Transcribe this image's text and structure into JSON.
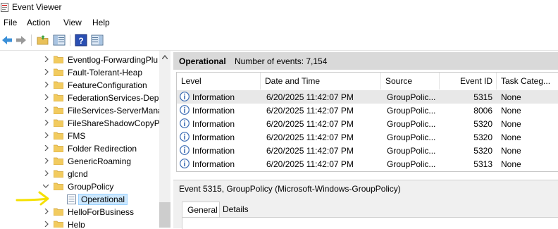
{
  "window": {
    "title": "Event Viewer"
  },
  "menu": {
    "items": [
      "File",
      "Action",
      "View",
      "Help"
    ]
  },
  "toolbar": {
    "icons": [
      "back-arrow-icon",
      "forward-arrow-icon",
      "open-folder-icon",
      "console-tree-icon",
      "help-icon",
      "action-pane-icon"
    ]
  },
  "tree": {
    "items": [
      {
        "label": "Eventlog-ForwardingPlu",
        "expanded": false
      },
      {
        "label": "Fault-Tolerant-Heap",
        "expanded": false
      },
      {
        "label": "FeatureConfiguration",
        "expanded": false
      },
      {
        "label": "FederationServices-Depl",
        "expanded": false
      },
      {
        "label": "FileServices-ServerMana",
        "expanded": false
      },
      {
        "label": "FileShareShadowCopyPr",
        "expanded": false
      },
      {
        "label": "FMS",
        "expanded": false
      },
      {
        "label": "Folder Redirection",
        "expanded": false
      },
      {
        "label": "GenericRoaming",
        "expanded": false
      },
      {
        "label": "glcnd",
        "expanded": false
      },
      {
        "label": "GroupPolicy",
        "expanded": true
      },
      {
        "label": "Operational",
        "selected": true,
        "child": true
      },
      {
        "label": "HelloForBusiness",
        "expanded": false
      },
      {
        "label": "Help",
        "expanded": false
      }
    ]
  },
  "log": {
    "name": "Operational",
    "count_text": "Number of events: 7,154"
  },
  "columns": [
    "Level",
    "Date and Time",
    "Source",
    "Event ID",
    "Task Categ..."
  ],
  "events": [
    {
      "level": "Information",
      "datetime": "6/20/2025 11:42:07 PM",
      "source": "GroupPolic...",
      "event_id": "5315",
      "task": "None"
    },
    {
      "level": "Information",
      "datetime": "6/20/2025 11:42:07 PM",
      "source": "GroupPolic...",
      "event_id": "8006",
      "task": "None"
    },
    {
      "level": "Information",
      "datetime": "6/20/2025 11:42:07 PM",
      "source": "GroupPolic...",
      "event_id": "5320",
      "task": "None"
    },
    {
      "level": "Information",
      "datetime": "6/20/2025 11:42:07 PM",
      "source": "GroupPolic...",
      "event_id": "5320",
      "task": "None"
    },
    {
      "level": "Information",
      "datetime": "6/20/2025 11:42:07 PM",
      "source": "GroupPolic...",
      "event_id": "5320",
      "task": "None"
    },
    {
      "level": "Information",
      "datetime": "6/20/2025 11:42:07 PM",
      "source": "GroupPolic...",
      "event_id": "5313",
      "task": "None"
    }
  ],
  "detail": {
    "title": "Event 5315, GroupPolicy (Microsoft-Windows-GroupPolicy)",
    "tabs": [
      "General",
      "Details"
    ]
  },
  "colors": {
    "accent_selection": "#cce8ff",
    "header_bg": "#d9d9d9",
    "annotation": "#f5e000"
  }
}
